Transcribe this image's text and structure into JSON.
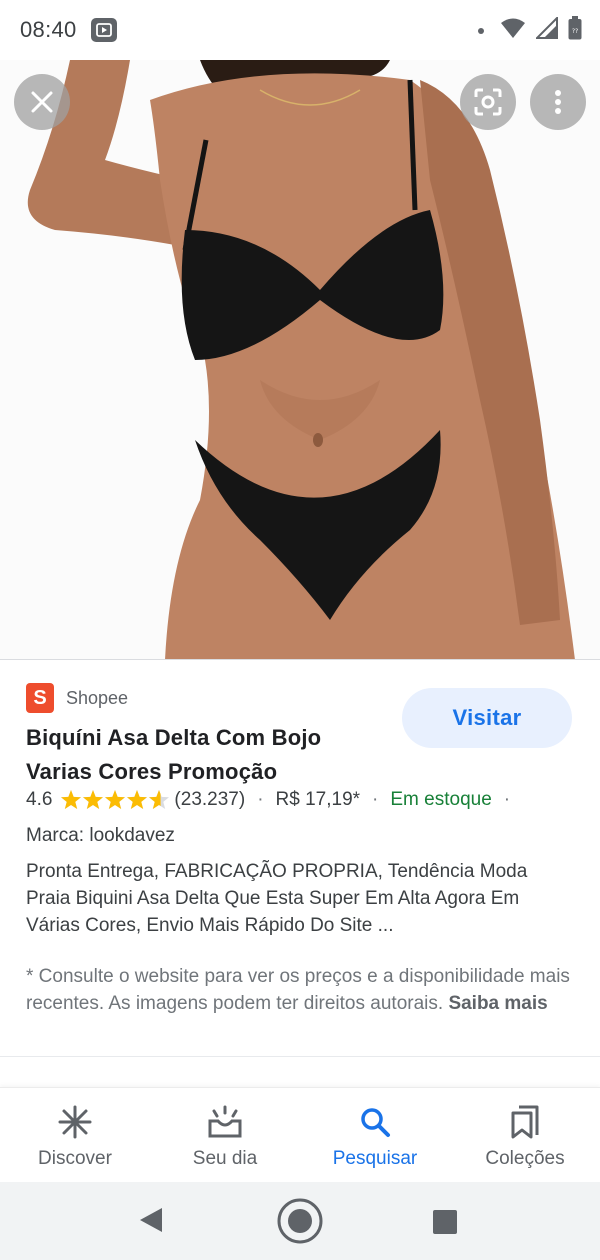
{
  "status_bar": {
    "time": "08:40",
    "battery_level": "??"
  },
  "image_viewer": {
    "icons": [
      "close-icon",
      "lens-icon",
      "more-vert-icon"
    ]
  },
  "result": {
    "source_name": "Shopee",
    "source_logo_letter": "S",
    "visit_label": "Visitar",
    "title": "Biquíni Asa Delta Com Bojo Varias Cores Promoção",
    "rating_value": "4.6",
    "rating_stars": 4.6,
    "rating_count": "(23.237)",
    "separator": "·",
    "price": "R$ 17,19*",
    "stock": "Em estoque",
    "brand": "Marca: lookdavez",
    "description": "Pronta Entrega, FABRICAÇÃO PROPRIA, Tendência Moda Praia Biquini Asa Delta Que Esta Super Em Alta Agora Em Várias Cores, Envio Mais Rápido Do Site ...",
    "disclaimer": "* Consulte o website para ver os preços e a disponibilidade mais recentes. As imagens podem ter direitos autorais.",
    "learn_more": "Saiba mais"
  },
  "bottom_nav": {
    "items": [
      {
        "label": "Discover",
        "icon": "asterisk-icon"
      },
      {
        "label": "Seu dia",
        "icon": "sunrise-icon"
      },
      {
        "label": "Pesquisar",
        "icon": "search-icon"
      },
      {
        "label": "Coleções",
        "icon": "collections-icon"
      }
    ],
    "active_index": 2
  },
  "colors": {
    "accent": "#1a73e8",
    "visit_bg": "#e8f0fe",
    "stock_green": "#188038",
    "star_gold": "#fbbc04",
    "shopee_orange": "#ee4d2d"
  }
}
